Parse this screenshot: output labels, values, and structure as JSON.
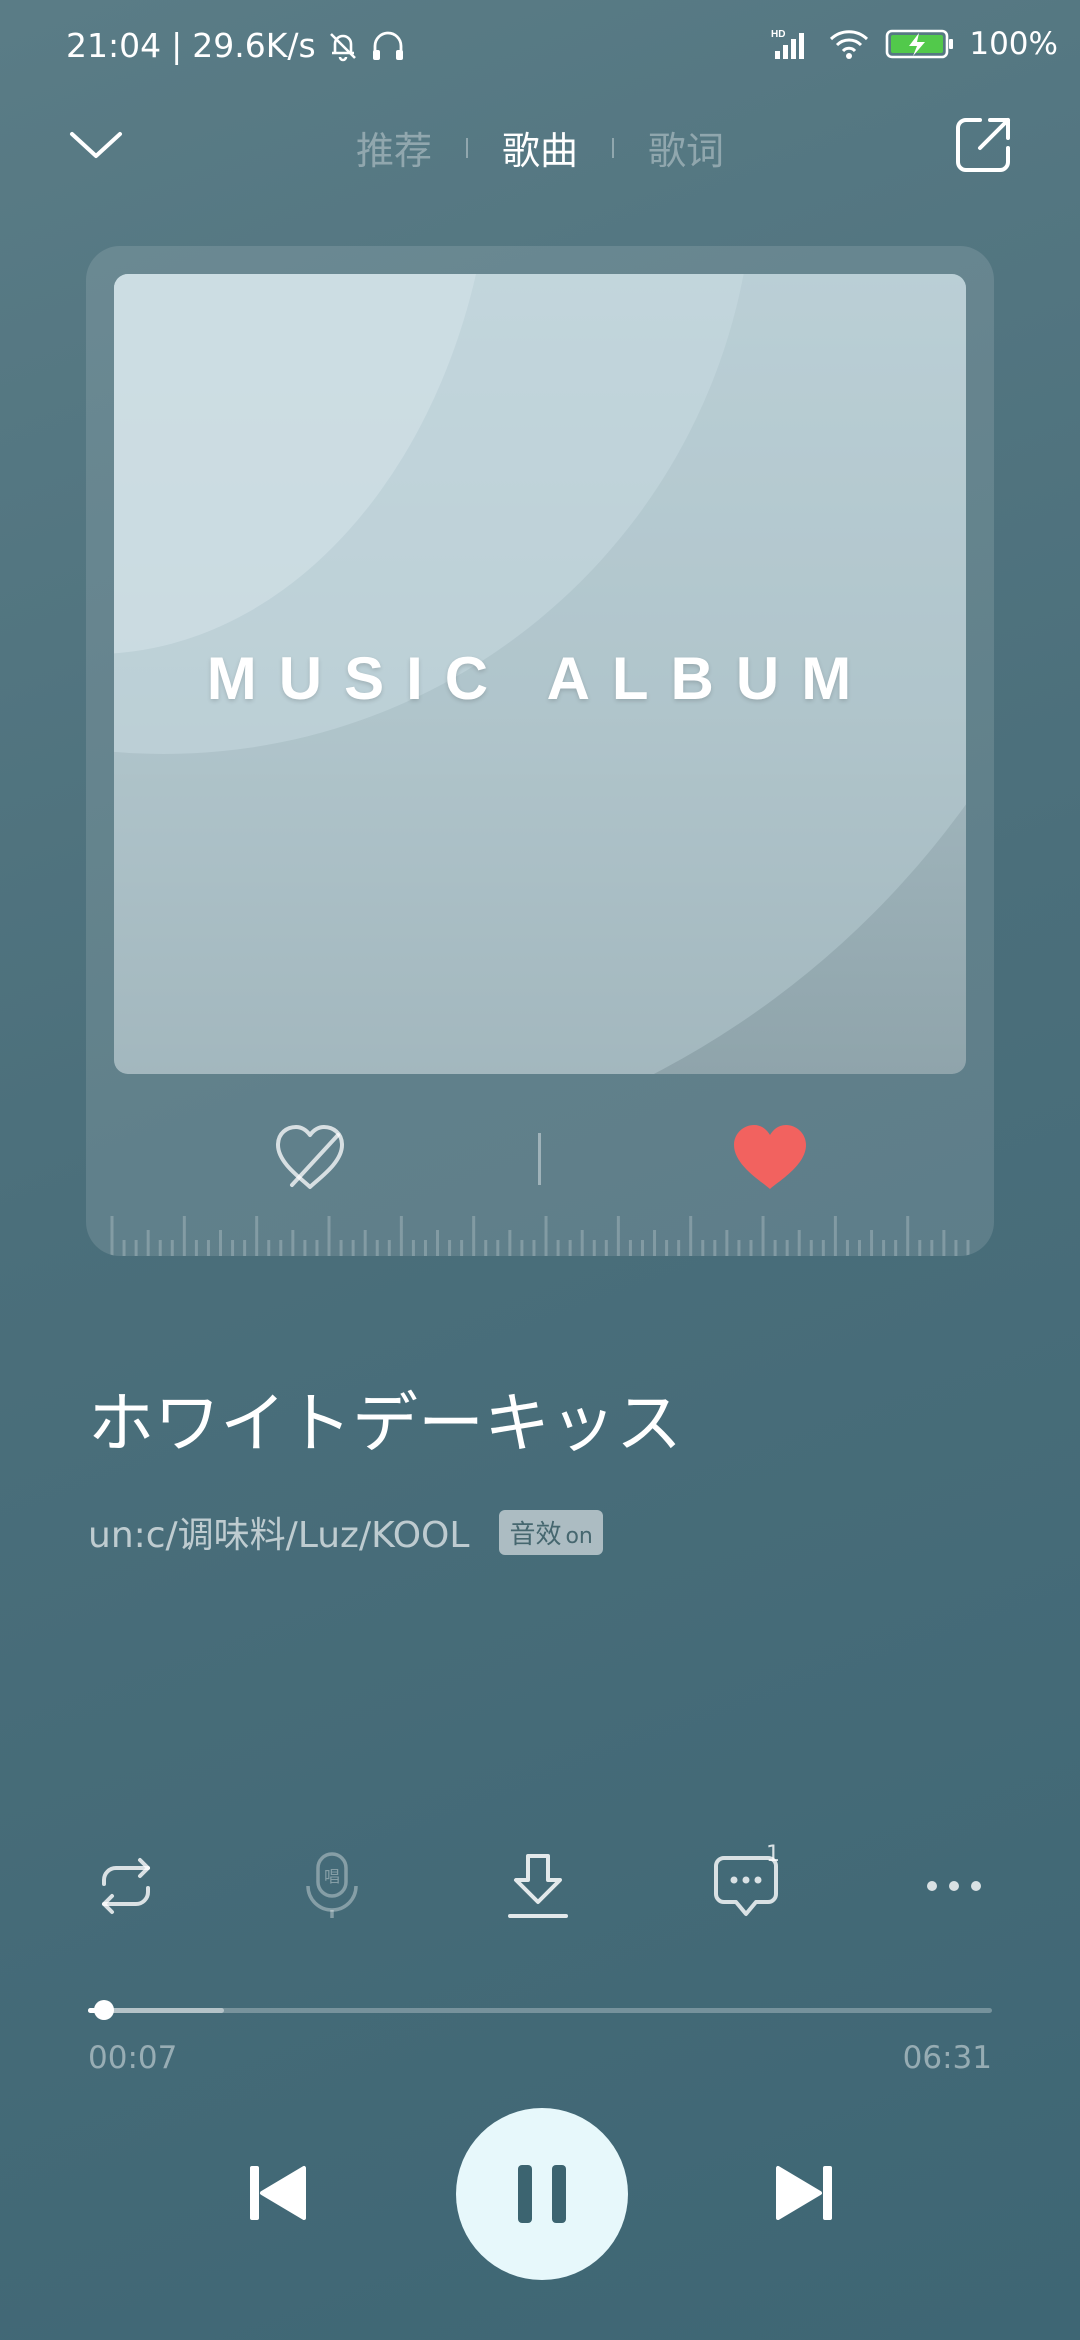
{
  "status_bar": {
    "time": "21:04",
    "net_speed": "29.6K/s",
    "battery": "100%",
    "icons": [
      "bell-muted-icon",
      "headphones-icon",
      "signal-icon",
      "wifi-icon",
      "battery-icon"
    ]
  },
  "nav": {
    "tabs": [
      {
        "label": "推荐",
        "active": false
      },
      {
        "label": "歌曲",
        "active": true
      },
      {
        "label": "歌词",
        "active": false
      }
    ]
  },
  "album": {
    "cover_text": "MUSIC ALBUM"
  },
  "song": {
    "title": "ホワイトデーキッス",
    "artist": "un:c/调味料/Luz/KOOL",
    "badge_main": "音效",
    "badge_on": "on"
  },
  "actions": {
    "comment_count": "1"
  },
  "progress": {
    "current": "00:07",
    "total": "06:31",
    "played_fraction": 0.018,
    "buffered_fraction": 0.15
  },
  "colors": {
    "like": "#f2625f",
    "play_button_bg": "#e7f8fb",
    "play_icon": "#3c6470"
  }
}
